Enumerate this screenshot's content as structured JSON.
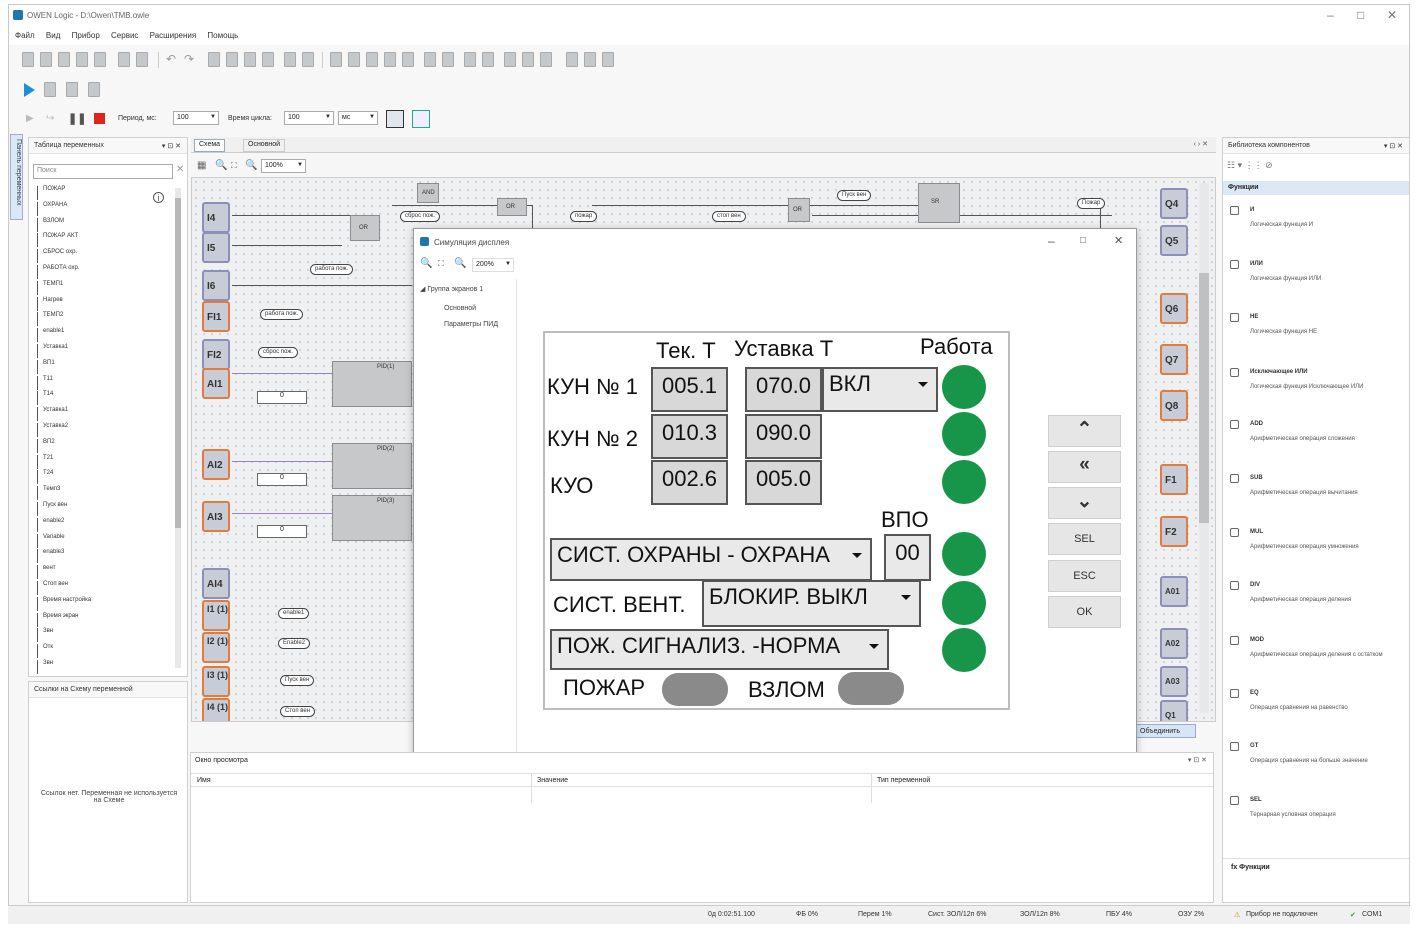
{
  "app": {
    "title": "OWEN Logic - D:\\Owen\\TMB.owle",
    "menu": [
      "Файл",
      "Вид",
      "Прибор",
      "Сервис",
      "Расширения",
      "Помощь"
    ]
  },
  "sim_toolbar": {
    "period_label": "Период, мс:",
    "period_value": "100",
    "cycle_label": "Время цикла:",
    "cycle_value": "100",
    "cycle_unit": "мс"
  },
  "variables_panel": {
    "title": "Таблица переменных",
    "search_placeholder": "Поиск",
    "side_tab": "Панель переменных",
    "items": [
      "ПОЖАР",
      "ОХРАНА",
      "ВЗЛОМ",
      "ПОЖАР АКТ",
      "СБРОС охр.",
      "РАБОТА охр.",
      "ТЕМП1",
      "Нагрев",
      "ТЕМП2",
      "enable1",
      "Уставка1",
      "ВП1",
      "Т11",
      "Т14",
      "Уставка1",
      "Уставка2",
      "ВП2",
      "Т21",
      "Т24",
      "Темп3",
      "Пуск вен",
      "enable2",
      "Variable",
      "enable3",
      "вент",
      "Стоп вен",
      "Время настройка",
      "Время экран",
      "Звн",
      "Отк",
      "Звн"
    ],
    "links_title": "Ссылки на Схему переменной",
    "links_empty": "Ссылок нет. Переменная не используется на Схеме"
  },
  "tabs": [
    "Схема",
    "Основной"
  ],
  "diagram": {
    "zoom": "100%",
    "inputs_left": [
      "I4",
      "I5",
      "I6",
      "FI1",
      "FI2",
      "AI1",
      "AI2",
      "AI3",
      "AI4",
      "I1 (1)",
      "I2 (1)",
      "I3 (1)",
      "I4 (1)"
    ],
    "outputs_right": [
      "Q4",
      "Q5",
      "Q6",
      "Q7",
      "Q8",
      "F1",
      "F2",
      "A01",
      "A02",
      "A03",
      "Q1"
    ],
    "tags": [
      "сброс пож.",
      "работа пож.",
      "пожар",
      "стоп вен",
      "Пуск вен",
      "работа пож.",
      "сброс пож.",
      "enable1",
      "Enable2",
      "Пуск вен",
      "Стоп вен",
      "Пожар"
    ],
    "block_labels": [
      "OR",
      "AND",
      "OR",
      "OR",
      "SR",
      "PID(1)",
      "PID(2)",
      "PID(3)"
    ],
    "merge_button": "Объединить"
  },
  "sim_dialog": {
    "title": "Симуляция дисплея",
    "zoom": "200%",
    "tree": {
      "group": "Группа экранов 1",
      "screens": [
        "Основной",
        "Параметры ПИД"
      ]
    },
    "hmi": {
      "col_current": "Тек.  Т",
      "col_setpoint": "Уставка Т",
      "col_work": "Работа",
      "rows": [
        {
          "name": "КУН № 1",
          "current": "005.1",
          "setpoint": "070.0"
        },
        {
          "name": "КУН № 2",
          "current": "010.3",
          "setpoint": "090.0"
        },
        {
          "name": "КУО",
          "current": "002.6",
          "setpoint": "005.0"
        }
      ],
      "mode_select": "ВКЛ",
      "vpo_label": "ВПО",
      "vpo_value": "00",
      "security_select": "СИСТ. ОХРАНЫ - ОХРАНА",
      "vent_label": "СИСТ. ВЕНТ.",
      "vent_select": "БЛОКИР. ВЫКЛ",
      "fire_select": "ПОЖ. СИГНАЛИЗ. -НОРМА",
      "fire_label": "ПОЖАР",
      "breakin_label": "ВЗЛОМ"
    },
    "nav_buttons": [
      "SEL",
      "ESC",
      "OK"
    ],
    "colors": {
      "lamp_on": "#17964a",
      "lamp_off": "#8a8a8a"
    }
  },
  "library": {
    "title": "Библиотека компонентов",
    "section": "Функции",
    "items": [
      {
        "name": "И",
        "desc": "Логическая функция И"
      },
      {
        "name": "ИЛИ",
        "desc": "Логическая функция ИЛИ"
      },
      {
        "name": "НЕ",
        "desc": "Логическая функция НЕ"
      },
      {
        "name": "Исключающее ИЛИ",
        "desc": "Логическая функция Исключающее ИЛИ"
      },
      {
        "name": "ADD",
        "desc": "Арифметическая операция сложения"
      },
      {
        "name": "SUB",
        "desc": "Арифметическая операция вычитания"
      },
      {
        "name": "MUL",
        "desc": "Арифметическая операция умножения"
      },
      {
        "name": "DIV",
        "desc": "Арифметическая операция деления"
      },
      {
        "name": "MOD",
        "desc": "Арифметическая операция деления с остатком"
      },
      {
        "name": "EQ",
        "desc": "Операция сравнения на равенство"
      },
      {
        "name": "GT",
        "desc": "Операция сравнения на больше значение"
      },
      {
        "name": "SEL",
        "desc": "Тернарная условная операция"
      }
    ],
    "footer": "Функции"
  },
  "watch": {
    "title": "Окно просмотра",
    "columns": [
      "Имя",
      "Значение",
      "Тип переменной"
    ]
  },
  "statusbar": {
    "cells": [
      "0д 0:02:51.100",
      "ФБ 0%",
      "Перем 1%",
      "Сист. ЗОЛ/12п 6%",
      "ЗОЛ/12п 8%",
      "ПБУ 4%",
      "ОЗУ 2%"
    ],
    "device": "Прибор не подключен",
    "port": "COM1"
  }
}
